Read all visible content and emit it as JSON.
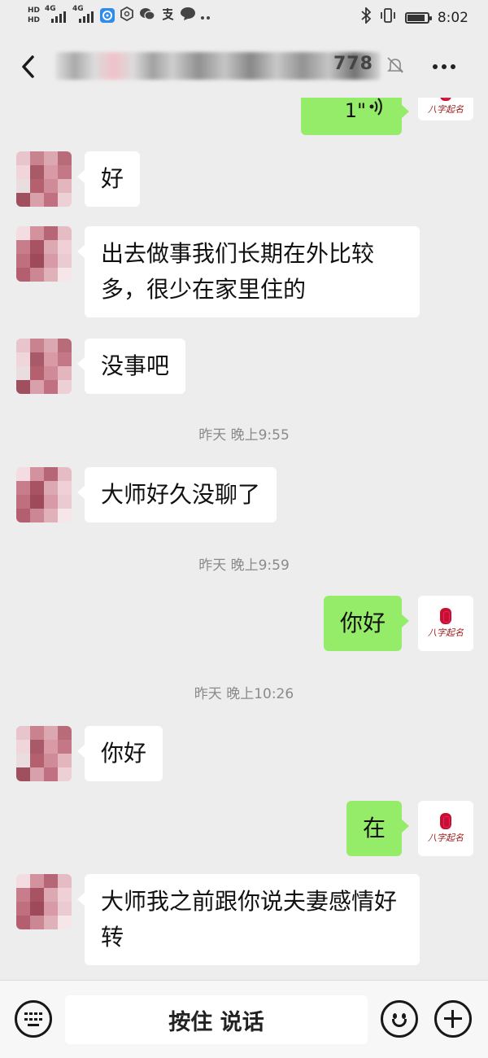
{
  "status_bar": {
    "hd_1": "HD",
    "hd_2": "HD",
    "net_1": "4G",
    "net_2": "4G",
    "time": "8:02"
  },
  "title_bar": {
    "title_tail": "778",
    "muted": true
  },
  "messages": [
    {
      "side": "out",
      "type": "voice",
      "duration": "1\""
    },
    {
      "side": "in",
      "text": "好"
    },
    {
      "side": "in",
      "text": "出去做事我们长期在外比较多，很少在家里住的"
    },
    {
      "side": "in",
      "text": "没事吧"
    },
    {
      "type": "timestamp",
      "text": "昨天 晚上9:55"
    },
    {
      "side": "in",
      "text": "大师好久没聊了"
    },
    {
      "type": "timestamp",
      "text": "昨天 晚上9:59"
    },
    {
      "side": "out",
      "text": "你好"
    },
    {
      "type": "timestamp",
      "text": "昨天 晚上10:26"
    },
    {
      "side": "in",
      "text": "你好"
    },
    {
      "side": "out",
      "text": "在"
    },
    {
      "side": "in",
      "text": "大师我之前跟你说夫妻感情好转"
    }
  ],
  "my_avatar_logo_text": "八字起名",
  "input_bar": {
    "hold_to_talk": "按住 说话"
  },
  "colors": {
    "background": "#ededed",
    "outgoing_bubble": "#95ec69",
    "incoming_bubble": "#ffffff",
    "timestamp_text": "#8a8a8a"
  },
  "icons": [
    "back-arrow-icon",
    "mute-bell-icon",
    "more-icon",
    "keyboard-icon",
    "emoji-icon",
    "plus-icon",
    "voice-wave-icon",
    "bluetooth-icon",
    "vibrate-icon",
    "battery-icon"
  ]
}
